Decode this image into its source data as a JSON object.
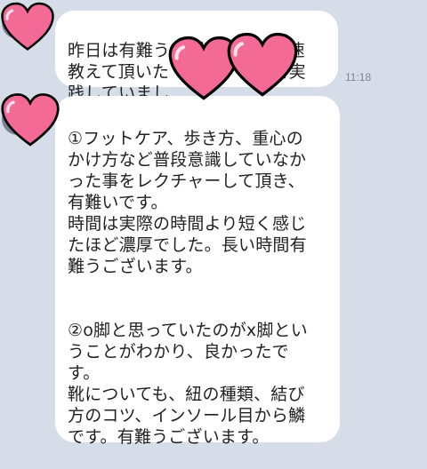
{
  "messages": [
    {
      "text": "昨日は有難うございます。早速\n教えて頂いた　　　　　　を実\n践していまし",
      "time": "11:18"
    },
    {
      "para1": "①フットケア、歩き方、重心の\nかけ方など普段意識していなか\nった事をレクチャーして頂き、\n有難いです。\n時間は実際の時間より短く感じ\nたほど濃厚でした。長い時間有\n難うございます。",
      "para2": "②o脚と思っていたのがx脚とい\nうことがわかり、良かったで\nす。\n靴についても、紐の種類、結び\n方のコツ、インソール目から鱗\nです。有難うございます。"
    }
  ],
  "colors": {
    "background": "#d7dde8",
    "bubble": "#ffffff",
    "text": "#222222",
    "timestamp": "#7f8794",
    "heart_fill": "#f46a97",
    "heart_outline": "#000000"
  },
  "stickers": [
    "heart-icon",
    "heart-icon",
    "heart-icon",
    "heart-icon"
  ]
}
